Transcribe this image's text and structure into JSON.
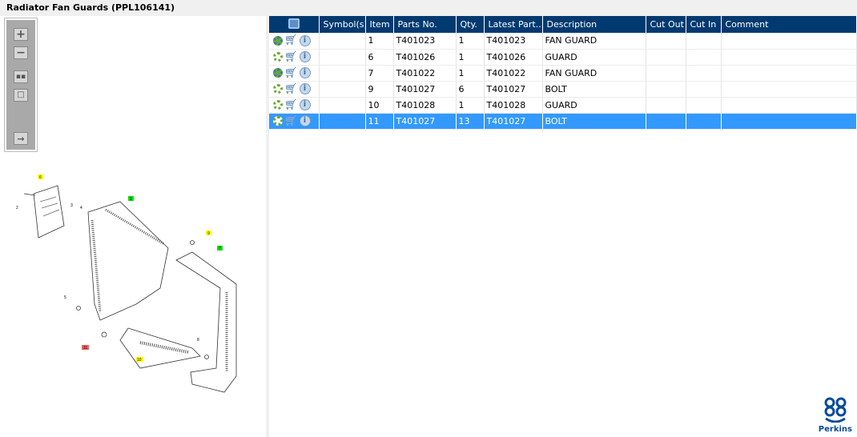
{
  "title": "Radiator Fan Guards (PPL106141)",
  "toolbar": {
    "icons": [
      "zoom-in-icon",
      "zoom-out-icon",
      "fit-all-icon",
      "actual-size-icon",
      "export-icon"
    ]
  },
  "diagram": {
    "callouts": [
      "1",
      "2",
      "3",
      "4",
      "5",
      "6",
      "7",
      "8",
      "9",
      "10",
      "11"
    ],
    "highlight_colors": {
      "yellow": "#ffff00",
      "green": "#00e000",
      "red": "#f06060"
    }
  },
  "table": {
    "columns": [
      "",
      "Symbol(s)",
      "Item",
      "Parts No.",
      "Qty.",
      "Latest Part...",
      "Description",
      "Cut Out",
      "Cut In",
      "Comment"
    ],
    "rows": [
      {
        "gear": "blue",
        "item": "1",
        "part": "T401023",
        "qty": "1",
        "latest": "T401023",
        "desc": "FAN GUARD"
      },
      {
        "gear": "green",
        "item": "6",
        "part": "T401026",
        "qty": "1",
        "latest": "T401026",
        "desc": "GUARD"
      },
      {
        "gear": "blue",
        "item": "7",
        "part": "T401022",
        "qty": "1",
        "latest": "T401022",
        "desc": "FAN GUARD"
      },
      {
        "gear": "green",
        "item": "9",
        "part": "T401027",
        "qty": "6",
        "latest": "T401027",
        "desc": "BOLT"
      },
      {
        "gear": "green",
        "item": "10",
        "part": "T401028",
        "qty": "1",
        "latest": "T401028",
        "desc": "GUARD"
      },
      {
        "gear": "green",
        "item": "11",
        "part": "T401027",
        "qty": "13",
        "latest": "T401027",
        "desc": "BOLT",
        "selected": true
      }
    ]
  },
  "colors": {
    "header": "#003a70",
    "selected": "#3399ff",
    "brand": "#0a4a9c"
  },
  "logo": {
    "text": "Perkins"
  }
}
